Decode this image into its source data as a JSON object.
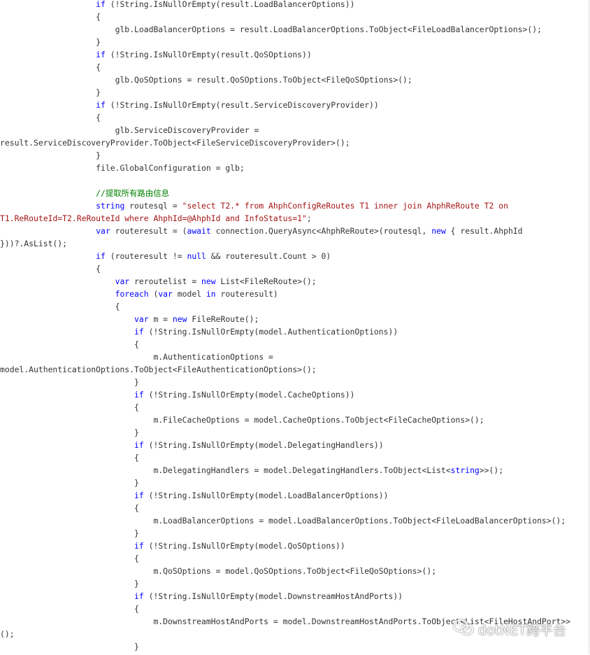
{
  "watermark": {
    "text": "dotNET跨平台",
    "icon": "wechat-icon"
  },
  "colors": {
    "keyword": "#0000ff",
    "string": "#a31515",
    "comment": "#008000",
    "text": "#333333"
  },
  "code": {
    "lines": [
      [
        {
          "t": "                    "
        },
        {
          "t": "if",
          "k": "kw"
        },
        {
          "t": " (!String.IsNullOrEmpty(result.LoadBalancerOptions))"
        }
      ],
      [
        {
          "t": "                    {"
        }
      ],
      [
        {
          "t": "                        glb.LoadBalancerOptions = result.LoadBalancerOptions.ToObject<FileLoadBalancerOptions>();"
        }
      ],
      [
        {
          "t": "                    }"
        }
      ],
      [
        {
          "t": "                    "
        },
        {
          "t": "if",
          "k": "kw"
        },
        {
          "t": " (!String.IsNullOrEmpty(result.QoSOptions))"
        }
      ],
      [
        {
          "t": "                    {"
        }
      ],
      [
        {
          "t": "                        glb.QoSOptions = result.QoSOptions.ToObject<FileQoSOptions>();"
        }
      ],
      [
        {
          "t": "                    }"
        }
      ],
      [
        {
          "t": "                    "
        },
        {
          "t": "if",
          "k": "kw"
        },
        {
          "t": " (!String.IsNullOrEmpty(result.ServiceDiscoveryProvider))"
        }
      ],
      [
        {
          "t": "                    {"
        }
      ],
      [
        {
          "t": "                        glb.ServiceDiscoveryProvider ="
        }
      ],
      [
        {
          "t": "result.ServiceDiscoveryProvider.ToObject<FileServiceDiscoveryProvider>();"
        }
      ],
      [
        {
          "t": "                    }"
        }
      ],
      [
        {
          "t": "                    file.GlobalConfiguration = glb;"
        }
      ],
      [
        {
          "t": ""
        }
      ],
      [
        {
          "t": "                    "
        },
        {
          "t": "//提取所有路由信息",
          "k": "cmt"
        }
      ],
      [
        {
          "t": "                    "
        },
        {
          "t": "string",
          "k": "kw"
        },
        {
          "t": " routesql = "
        },
        {
          "t": "\"select T2.* from AhphConfigReRoutes T1 inner join AhphReRoute T2 on",
          "k": "str"
        }
      ],
      [
        {
          "t": "T1.ReRouteId=T2.ReRouteId where AhphId=@AhphId and InfoStatus=1\"",
          "k": "str"
        },
        {
          "t": ";"
        }
      ],
      [
        {
          "t": "                    "
        },
        {
          "t": "var",
          "k": "kw"
        },
        {
          "t": " routeresult = ("
        },
        {
          "t": "await",
          "k": "kw"
        },
        {
          "t": " connection.QueryAsync<AhphReRoute>(routesql, "
        },
        {
          "t": "new",
          "k": "kw"
        },
        {
          "t": " { result.AhphId"
        }
      ],
      [
        {
          "t": "}))?.AsList();"
        }
      ],
      [
        {
          "t": "                    "
        },
        {
          "t": "if",
          "k": "kw"
        },
        {
          "t": " (routeresult != "
        },
        {
          "t": "null",
          "k": "kw"
        },
        {
          "t": " && routeresult.Count > 0)"
        }
      ],
      [
        {
          "t": "                    {"
        }
      ],
      [
        {
          "t": "                        "
        },
        {
          "t": "var",
          "k": "kw"
        },
        {
          "t": " reroutelist = "
        },
        {
          "t": "new",
          "k": "kw"
        },
        {
          "t": " List<FileReRoute>();"
        }
      ],
      [
        {
          "t": "                        "
        },
        {
          "t": "foreach",
          "k": "kw"
        },
        {
          "t": " ("
        },
        {
          "t": "var",
          "k": "kw"
        },
        {
          "t": " model "
        },
        {
          "t": "in",
          "k": "kw"
        },
        {
          "t": " routeresult)"
        }
      ],
      [
        {
          "t": "                        {"
        }
      ],
      [
        {
          "t": "                            "
        },
        {
          "t": "var",
          "k": "kw"
        },
        {
          "t": " m = "
        },
        {
          "t": "new",
          "k": "kw"
        },
        {
          "t": " FileReRoute();"
        }
      ],
      [
        {
          "t": "                            "
        },
        {
          "t": "if",
          "k": "kw"
        },
        {
          "t": " (!String.IsNullOrEmpty(model.AuthenticationOptions))"
        }
      ],
      [
        {
          "t": "                            {"
        }
      ],
      [
        {
          "t": "                                m.AuthenticationOptions ="
        }
      ],
      [
        {
          "t": "model.AuthenticationOptions.ToObject<FileAuthenticationOptions>();"
        }
      ],
      [
        {
          "t": "                            }"
        }
      ],
      [
        {
          "t": "                            "
        },
        {
          "t": "if",
          "k": "kw"
        },
        {
          "t": " (!String.IsNullOrEmpty(model.CacheOptions))"
        }
      ],
      [
        {
          "t": "                            {"
        }
      ],
      [
        {
          "t": "                                m.FileCacheOptions = model.CacheOptions.ToObject<FileCacheOptions>();"
        }
      ],
      [
        {
          "t": "                            }"
        }
      ],
      [
        {
          "t": "                            "
        },
        {
          "t": "if",
          "k": "kw"
        },
        {
          "t": " (!String.IsNullOrEmpty(model.DelegatingHandlers))"
        }
      ],
      [
        {
          "t": "                            {"
        }
      ],
      [
        {
          "t": "                                m.DelegatingHandlers = model.DelegatingHandlers.ToObject<List<"
        },
        {
          "t": "string",
          "k": "kw"
        },
        {
          "t": ">>();"
        }
      ],
      [
        {
          "t": "                            }"
        }
      ],
      [
        {
          "t": "                            "
        },
        {
          "t": "if",
          "k": "kw"
        },
        {
          "t": " (!String.IsNullOrEmpty(model.LoadBalancerOptions))"
        }
      ],
      [
        {
          "t": "                            {"
        }
      ],
      [
        {
          "t": "                                m.LoadBalancerOptions = model.LoadBalancerOptions.ToObject<FileLoadBalancerOptions>();"
        }
      ],
      [
        {
          "t": "                            }"
        }
      ],
      [
        {
          "t": "                            "
        },
        {
          "t": "if",
          "k": "kw"
        },
        {
          "t": " (!String.IsNullOrEmpty(model.QoSOptions))"
        }
      ],
      [
        {
          "t": "                            {"
        }
      ],
      [
        {
          "t": "                                m.QoSOptions = model.QoSOptions.ToObject<FileQoSOptions>();"
        }
      ],
      [
        {
          "t": "                            }"
        }
      ],
      [
        {
          "t": "                            "
        },
        {
          "t": "if",
          "k": "kw"
        },
        {
          "t": " (!String.IsNullOrEmpty(model.DownstreamHostAndPorts))"
        }
      ],
      [
        {
          "t": "                            {"
        }
      ],
      [
        {
          "t": "                                m.DownstreamHostAndPorts = model.DownstreamHostAndPorts.ToObject<List<FileHostAndPort>>"
        }
      ],
      [
        {
          "t": "();"
        }
      ],
      [
        {
          "t": "                            }"
        }
      ]
    ]
  }
}
